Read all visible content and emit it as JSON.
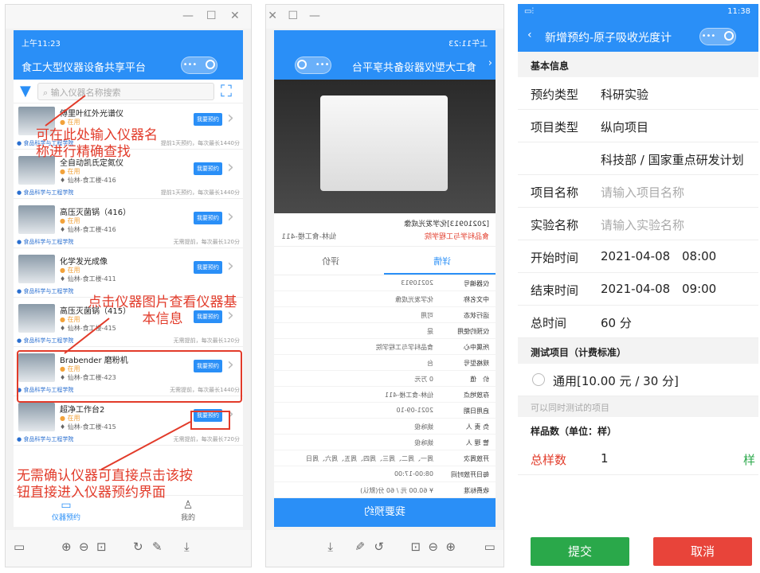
{
  "left": {
    "time": "上午11:23",
    "title": "食工大型仪器设备共享平台",
    "search_placeholder": "输入仪器名称搜索",
    "items": [
      {
        "name": "傅里叶红外光谱仪",
        "status": "● 在用",
        "location": "",
        "btn": "我要预约",
        "college": "● 食品科学与工程学院",
        "note": "提前1天预约，每次最长1440分"
      },
      {
        "name": "全自动凯氏定氮仪",
        "status": "● 在用",
        "location": "♦ 仙林-食工楼-416",
        "btn": "我要预约",
        "college": "● 食品科学与工程学院",
        "note": "提前1天预约，每次最长1440分"
      },
      {
        "name": "高压灭菌锅（416）",
        "status": "● 在用",
        "location": "♦ 仙林-食工楼-416",
        "btn": "我要预约",
        "college": "● 食品科学与工程学院",
        "note": "无需提前，每次最长120分"
      },
      {
        "name": "化学发光成像",
        "status": "● 在用",
        "location": "♦ 仙林-食工楼-411",
        "btn": "我要预约",
        "college": "● 食品科学与工程学院",
        "note": ""
      },
      {
        "name": "高压灭菌锅（415）",
        "status": "● 在用",
        "location": "♦ 仙林-食工楼-415",
        "btn": "我要预约",
        "college": "● 食品科学与工程学院",
        "note": "无需提前，每次最长120分"
      },
      {
        "name": "Brabender 磨粉机",
        "status": "● 在用",
        "location": "♦ 仙林-食工楼-423",
        "btn": "我要预约",
        "college": "● 食品科学与工程学院",
        "note": "无需提前，每次最长1440分"
      },
      {
        "name": "超净工作台2",
        "status": "● 在用",
        "location": "♦ 仙林-食工楼-415",
        "btn": "我要预约",
        "college": "● 食品科学与工程学院",
        "note": "无需提前，每次最长720分"
      }
    ],
    "tab_booking": "仪器预约",
    "tab_mine": "我的",
    "ann1": "可在此处输入仪器名称进行精确查找",
    "ann2": "点击仪器图片查看仪器基本信息",
    "ann3": "无需确认仪器可直接点击该按钮直接进入仪器预约界面"
  },
  "middle": {
    "time": "上午11:23",
    "title": "食工大型仪器设备共享平台",
    "code_name": "[20210913]化学发光成像",
    "college": "食品科学与工程学院",
    "loc": "仙林-食工楼-411",
    "tab_detail": "详情",
    "tab_review": "评价",
    "rows": [
      {
        "k": "仪器编号",
        "v": "20210913"
      },
      {
        "k": "中文名称",
        "v": "化学发光成像"
      },
      {
        "k": "运行状态",
        "v": "可用"
      },
      {
        "k": "仪预约使用",
        "v": "是"
      },
      {
        "k": "所属中心",
        "v": "食品科学与工程学院"
      },
      {
        "k": "规格型号",
        "v": "台"
      },
      {
        "k": "价　值",
        "v": "0 万元"
      },
      {
        "k": "存放地点",
        "v": "仙林-食工楼-411"
      },
      {
        "k": "启用日期",
        "v": "2021-09-10"
      },
      {
        "k": "负 责 人",
        "v": "姚咏俊"
      },
      {
        "k": "管 理 人",
        "v": "姚咏俊"
      },
      {
        "k": "开放周次",
        "v": "周一、周二、周三、周四、周五、周六、周日"
      },
      {
        "k": "每日开放时间",
        "v": "08:00-17:00"
      },
      {
        "k": "收费标准",
        "v": "¥ 60.00 元 / 60 分(默认)"
      }
    ],
    "book_btn": "我要预约"
  },
  "right": {
    "title": "新增预约-原子吸收光度计",
    "status_time": "11:38",
    "section_basic": "基本信息",
    "rows": [
      {
        "k": "预约类型",
        "v": "科研实验"
      },
      {
        "k": "项目类型",
        "v": "纵向项目"
      },
      {
        "k": "",
        "v": "科技部 / 国家重点研发计划"
      },
      {
        "k": "项目名称",
        "v": "请输入项目名称"
      },
      {
        "k": "实验名称",
        "v": "请输入实验名称"
      },
      {
        "k": "开始时间",
        "v": "2021-04-08",
        "t": "08:00"
      },
      {
        "k": "结束时间",
        "v": "2021-04-08",
        "t": "09:00"
      },
      {
        "k": "总时间",
        "v": "60 分"
      }
    ],
    "section_test": "测试项目（计费标准）",
    "test_option": "通用[10.00 元 / 30 分]",
    "simul": "可以同时测试的项目",
    "section_sample": "样品数（单位：样）",
    "total_label": "总样数",
    "total_val": "1",
    "unit": "样",
    "submit": "提交",
    "cancel": "取消"
  }
}
